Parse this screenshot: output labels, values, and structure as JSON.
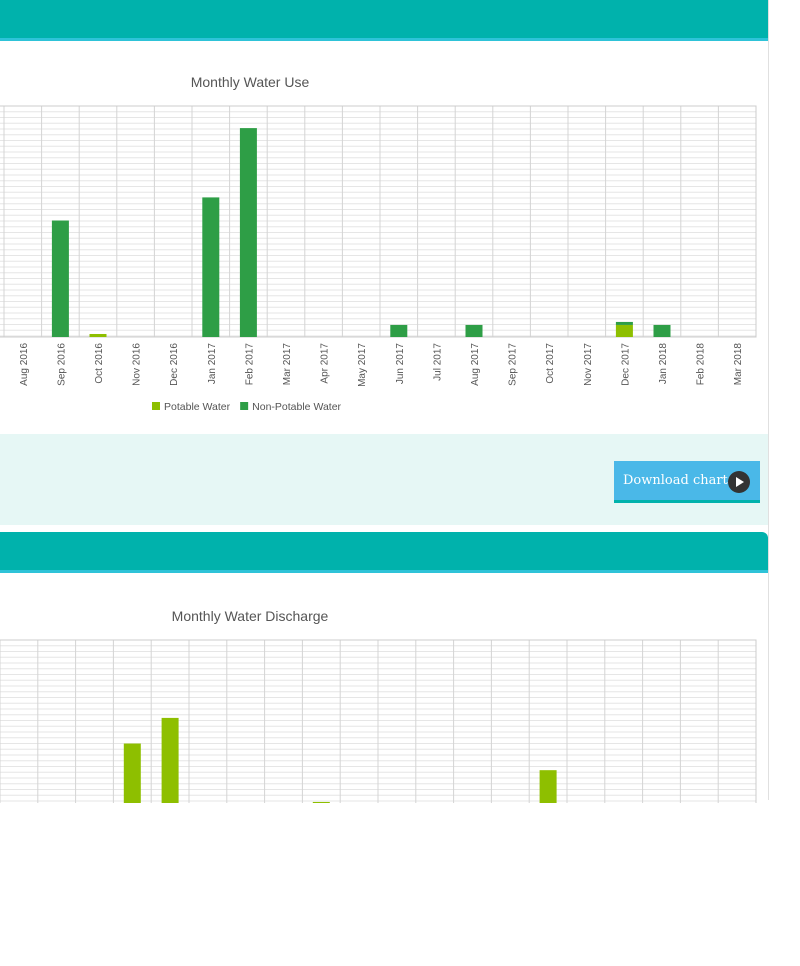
{
  "colors": {
    "header": "#00b2ac",
    "potable": "#8ebf00",
    "non_potable": "#2e9e46",
    "grid": "#dddddd",
    "button": "#4ab8e8"
  },
  "download_label": "Download chart",
  "chart_data": [
    {
      "type": "bar",
      "stacked": true,
      "title": "Monthly Water Use",
      "categories": [
        "Aug 2016",
        "Sep 2016",
        "Oct 2016",
        "Nov 2016",
        "Dec 2016",
        "Jan 2017",
        "Feb 2017",
        "Mar 2017",
        "Apr 2017",
        "May 2017",
        "Jun 2017",
        "Jul 2017",
        "Aug 2017",
        "Sep 2017",
        "Oct 2017",
        "Nov 2017",
        "Dec 2017",
        "Jan 2018",
        "Feb 2018",
        "Mar 2018"
      ],
      "series": [
        {
          "name": "Potable Water",
          "color": "#8ebf00",
          "values": [
            0,
            0,
            0.3,
            0,
            0,
            0,
            0,
            0,
            0,
            0,
            0,
            0,
            0,
            0,
            0,
            0,
            1.2,
            0,
            0,
            0
          ]
        },
        {
          "name": "Non-Potable Water",
          "color": "#2e9e46",
          "values": [
            0,
            11.6,
            0,
            0,
            0,
            13.9,
            20.8,
            0,
            0,
            0,
            1.2,
            0,
            1.2,
            0,
            0,
            0,
            0.3,
            1.2,
            0,
            0
          ]
        }
      ],
      "ylim": [
        0,
        23
      ],
      "grid": true,
      "legend_position": "bottom"
    },
    {
      "type": "bar",
      "title": "Monthly Water Discharge",
      "categories": [
        "",
        "",
        "",
        "",
        "",
        "",
        "",
        "",
        "",
        "",
        "",
        "",
        "",
        "",
        "",
        "",
        "",
        "",
        "",
        ""
      ],
      "series": [
        {
          "name": "",
          "color": "#8ebf00",
          "values": [
            0,
            0,
            0,
            5.9,
            8.4,
            0,
            0,
            0,
            0.2,
            0,
            0,
            0,
            0,
            0,
            3.3,
            0,
            0,
            0,
            0,
            0
          ]
        }
      ],
      "ylim": [
        0,
        16
      ],
      "grid": true
    }
  ]
}
